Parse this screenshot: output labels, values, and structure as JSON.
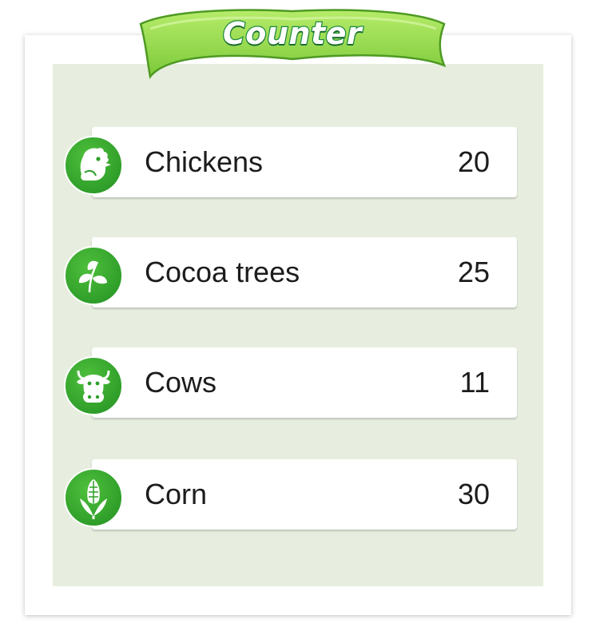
{
  "header": {
    "title": "Counter"
  },
  "counter": {
    "items": [
      {
        "label": "Chickens",
        "count": "20",
        "icon": "chicken-icon"
      },
      {
        "label": "Cocoa trees",
        "count": "25",
        "icon": "cocoa-leaf-icon"
      },
      {
        "label": "Cows",
        "count": "11",
        "icon": "cow-icon"
      },
      {
        "label": "Corn",
        "count": "30",
        "icon": "corn-icon"
      }
    ]
  },
  "colors": {
    "banner_green": "#8fd644",
    "badge_green": "#2f9f2a",
    "panel_bg": "#e7eedf"
  }
}
